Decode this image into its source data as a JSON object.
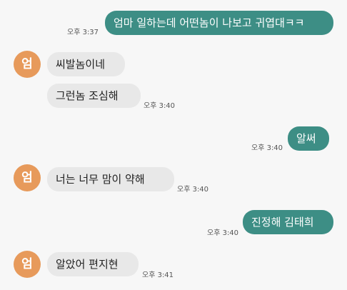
{
  "messages": [
    {
      "side": "out",
      "text": "엄마 일하는데 어떤놈이 나보고 귀엽대ㅋㅋ",
      "time": "오후 3:37"
    },
    {
      "side": "in",
      "avatar": "엄",
      "text": "씨발놈이네"
    },
    {
      "side": "in",
      "text": "그런놈 조심해",
      "time": "오후 3:40"
    },
    {
      "side": "out",
      "text": "알써",
      "time": "오후 3:40"
    },
    {
      "side": "in",
      "avatar": "엄",
      "text": "너는 너무 맘이 약해",
      "time": "오후 3:40"
    },
    {
      "side": "out",
      "text": "진정해 김태희",
      "time": "오후 3:40"
    },
    {
      "side": "in",
      "avatar": "엄",
      "text": "알았어 편지현",
      "time": "오후 3:41"
    }
  ],
  "colors": {
    "outgoing_bubble": "#3d8e85",
    "incoming_bubble": "#e8e8e8",
    "avatar": "#e79a5b",
    "background": "#f7f7f7"
  }
}
